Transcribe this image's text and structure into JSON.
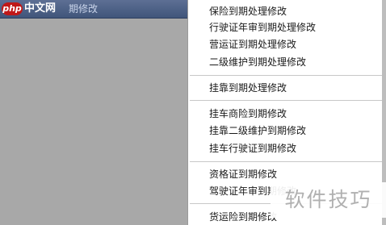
{
  "background_window": {
    "logo_badge": "php",
    "logo_text": "中文网",
    "title_fragment": "期修改"
  },
  "menu": {
    "items": [
      {
        "label": "保险到期处理修改"
      },
      {
        "label": "行驶证年审到期处理修改"
      },
      {
        "label": "营运证到期处理修改"
      },
      {
        "label": "二级维护到期处理修改"
      },
      {
        "label": "挂靠到期处理修改"
      },
      {
        "label": "挂车商险到期修改"
      },
      {
        "label": "挂靠二级维护到期修改"
      },
      {
        "label": "挂车行驶证到期修改"
      },
      {
        "label": "资格证到期修改"
      },
      {
        "label": "驾驶证年审到期修改"
      },
      {
        "label": "货运险到期修改"
      }
    ]
  },
  "watermark": "软件技巧",
  "colors": {
    "titlebar": "#40557a",
    "logo_badge": "#c01818",
    "menu_bg": "#ffffff",
    "separator": "#c8c8c8",
    "desktop_bg": "#a3a3a3"
  }
}
